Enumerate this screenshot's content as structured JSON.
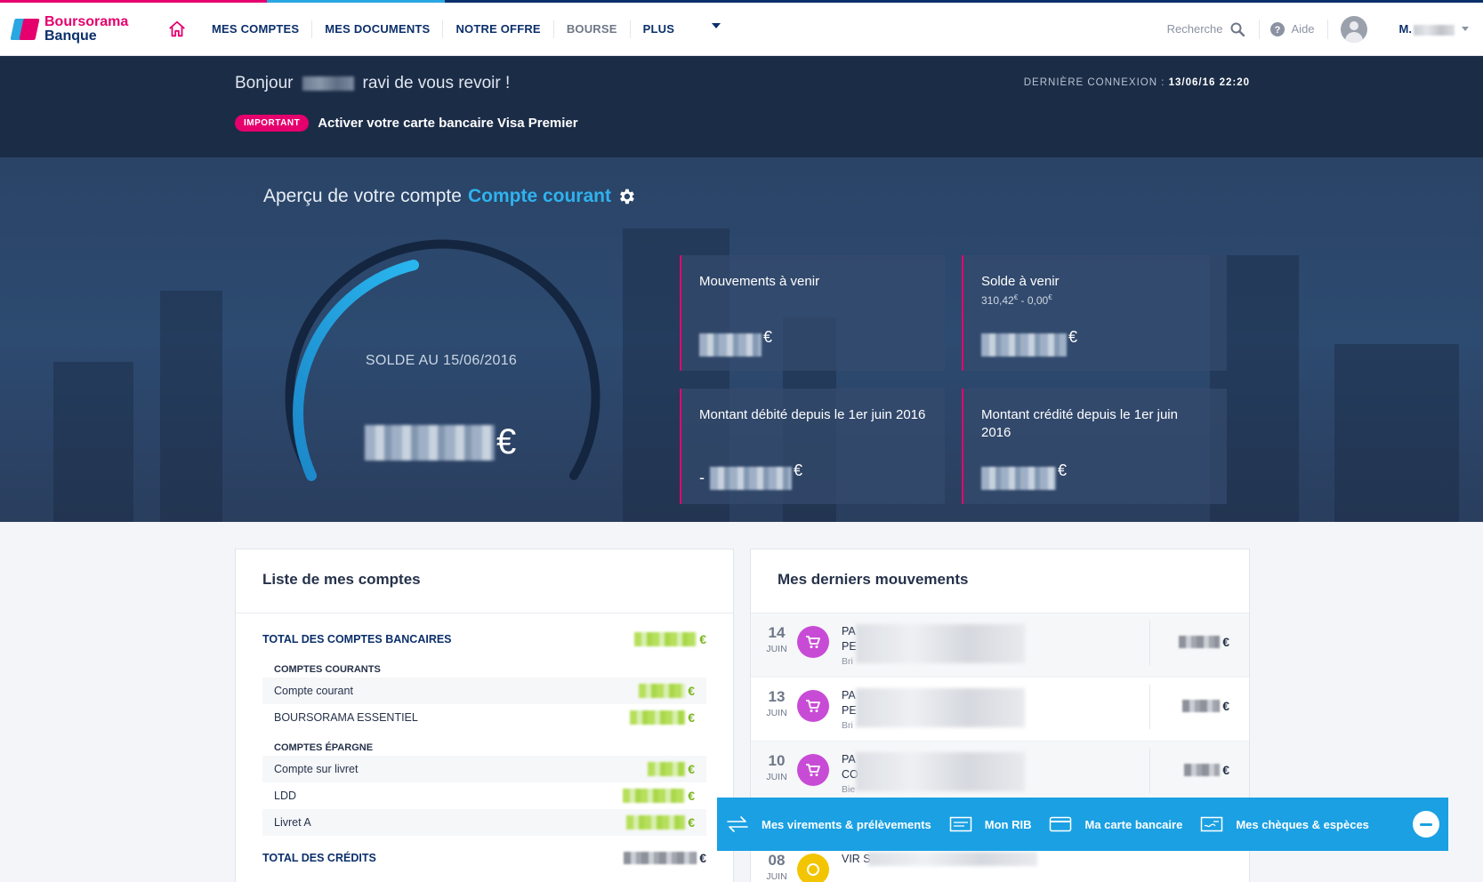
{
  "brand": {
    "line1": "Boursorama",
    "line2": "Banque"
  },
  "nav": {
    "items": [
      {
        "label": "MES COMPTES",
        "muted": false
      },
      {
        "label": "MES DOCUMENTS",
        "muted": false
      },
      {
        "label": "NOTRE OFFRE",
        "muted": false
      },
      {
        "label": "BOURSE",
        "muted": true
      },
      {
        "label": "PLUS",
        "muted": false
      }
    ],
    "search_label": "Recherche",
    "help_label": "Aide",
    "user_initial": "M."
  },
  "greeting": {
    "hello": "Bonjour",
    "rest": "ravi de vous revoir !",
    "last_login_label": "DERNIÈRE CONNEXION :",
    "last_login_value": "13/06/16 22:20",
    "badge": "IMPORTANT",
    "notice": "Activer votre carte bancaire Visa Premier"
  },
  "hero": {
    "title_prefix": "Aperçu de votre compte",
    "account_name": "Compte courant",
    "balance_label": "SOLDE AU 15/06/2016",
    "currency": "€",
    "cards": [
      {
        "title": "Mouvements à venir",
        "sub": ""
      },
      {
        "title": "Solde à venir",
        "sub_a": "310,42",
        "sub_b": "0,00"
      },
      {
        "title": "Montant débité depuis le 1er juin 2016",
        "sub": "",
        "sign": "-"
      },
      {
        "title": "Montant crédité depuis le 1er juin 2016",
        "sub": ""
      }
    ]
  },
  "accounts": {
    "title": "Liste de mes comptes",
    "total_bank": "TOTAL DES COMPTES BANCAIRES",
    "group_current": "COMPTES COURANTS",
    "current": [
      "Compte courant",
      "BOURSORAMA ESSENTIEL"
    ],
    "group_savings": "COMPTES ÉPARGNE",
    "savings": [
      "Compte sur livret",
      "LDD",
      "Livret A"
    ],
    "total_credits": "TOTAL DES CRÉDITS",
    "currency": "€"
  },
  "movements": {
    "title": "Mes derniers mouvements",
    "rows": [
      {
        "day": "14",
        "month": "JUIN",
        "l1": "PA",
        "l2": "PE",
        "l3": "Bri",
        "icon": "cart-icon"
      },
      {
        "day": "13",
        "month": "JUIN",
        "l1": "PA",
        "l2": "PE",
        "l3": "Bri",
        "icon": "cart-icon"
      },
      {
        "day": "10",
        "month": "JUIN",
        "l1": "PA",
        "l2": "CO",
        "l3": "Bie",
        "icon": "cart-icon"
      },
      {
        "day": "08",
        "month": "JUIN",
        "l1": "VIR S",
        "l2": "",
        "l3": "",
        "icon": "coin-icon"
      }
    ],
    "currency": "€"
  },
  "quickbar": {
    "transfers": "Mes virements & prélèvements",
    "rib": "Mon RIB",
    "card": "Ma carte bancaire",
    "cheques": "Mes chèques & espèces"
  },
  "colors": {
    "brand_pink": "#e5006d",
    "brand_navy": "#0b2f6b",
    "accent_blue": "#1aa0e3",
    "positive_green": "#7ab51d"
  }
}
